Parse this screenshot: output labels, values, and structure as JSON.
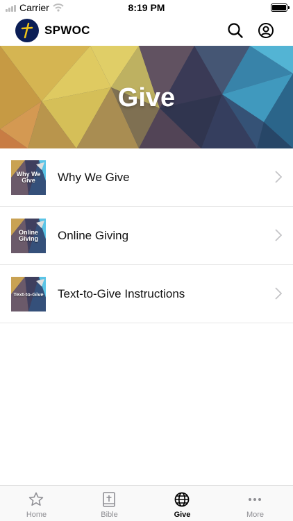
{
  "status_bar": {
    "carrier": "Carrier",
    "time": "8:19 PM"
  },
  "header": {
    "title": "SPWOC",
    "icons": [
      "search-icon",
      "account-icon"
    ]
  },
  "banner": {
    "title": "Give"
  },
  "items": [
    {
      "label": "Why We Give",
      "thumb_text": "Why We\nGive"
    },
    {
      "label": "Online Giving",
      "thumb_text": "Online\nGiving"
    },
    {
      "label": "Text-to-Give Instructions",
      "thumb_text": "Text-to-Give"
    }
  ],
  "tabs": [
    {
      "label": "Home",
      "icon": "star-icon",
      "active": false
    },
    {
      "label": "Bible",
      "icon": "bible-icon",
      "active": false
    },
    {
      "label": "Give",
      "icon": "globe-icon",
      "active": true
    },
    {
      "label": "More",
      "icon": "more-icon",
      "active": false
    }
  ],
  "colors": {
    "logo_bg": "#0b1e56",
    "inactive_tab": "#8e8e93",
    "active_tab": "#000000"
  }
}
